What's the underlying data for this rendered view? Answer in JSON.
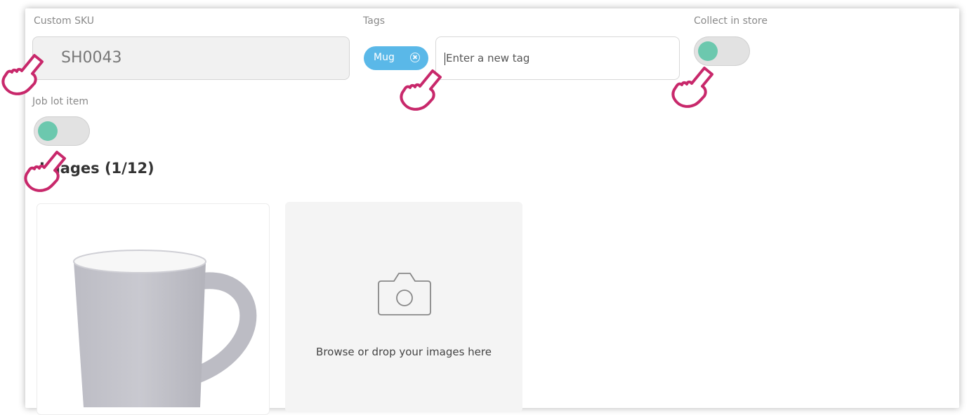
{
  "fields": {
    "custom_sku": {
      "label": "Custom SKU",
      "value": "SH0043"
    },
    "tags": {
      "label": "Tags",
      "items": [
        "Mug"
      ],
      "placeholder": "Enter a new tag"
    },
    "collect_in_store": {
      "label": "Collect in store",
      "state": "off"
    },
    "job_lot_item": {
      "label": "Job lot item",
      "state": "off"
    }
  },
  "images": {
    "title": "Images (1/12)",
    "thumbnails": [
      {
        "icon": "mug-image"
      }
    ],
    "dropzone_text": "Browse or drop your images here",
    "dropzone_icon": "camera-icon"
  },
  "colors": {
    "tag_chip": "#5ab8e8",
    "toggle_knob": "#6cc8ae",
    "cursor_annotation": "#c8286b"
  },
  "annotations": {
    "icon": "hand-pointer-icon",
    "count": 4
  }
}
